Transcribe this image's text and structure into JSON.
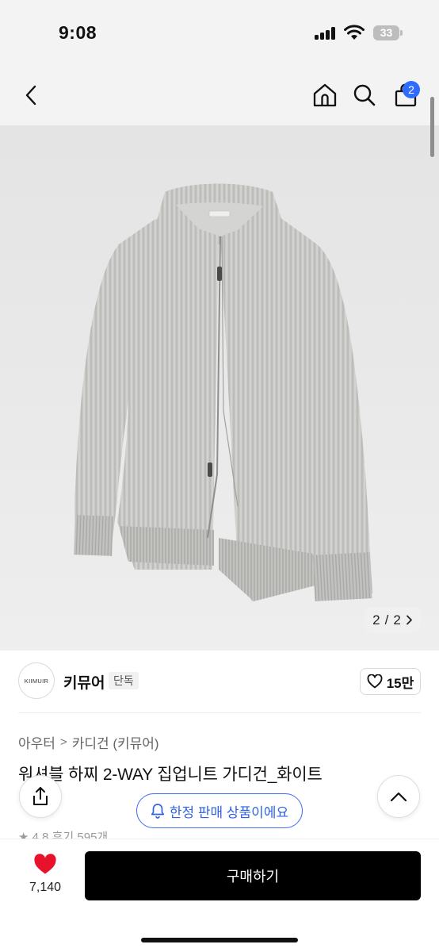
{
  "status_bar": {
    "time": "9:08",
    "battery": "33"
  },
  "nav": {
    "cart_count": "2"
  },
  "gallery": {
    "current": "2",
    "separator": "/",
    "total": "2"
  },
  "brand": {
    "logo_text": "KIIMUIR",
    "name": "키뮤어",
    "badge": "단독",
    "likes": "15만"
  },
  "breadcrumb": {
    "items": [
      "아우터",
      "카디건 (키뮤어)"
    ],
    "separator": ">"
  },
  "product": {
    "title": "워셔블 하찌 2-WAY 집업니트 가디건_화이트",
    "rating_peek": "★ 4.8 후기 595개"
  },
  "notice": {
    "limited_label": "한정 판매 상품이에요"
  },
  "footer": {
    "wish_count": "7,140",
    "buy_label": "구매하기"
  },
  "colors": {
    "accent": "#2f6bff",
    "heart": "#e8122d",
    "buy": "#000000"
  },
  "icons": [
    "back-icon",
    "home-icon",
    "search-icon",
    "cart-icon",
    "share-icon",
    "chevron-up-icon",
    "bell-icon",
    "heart-icon"
  ]
}
